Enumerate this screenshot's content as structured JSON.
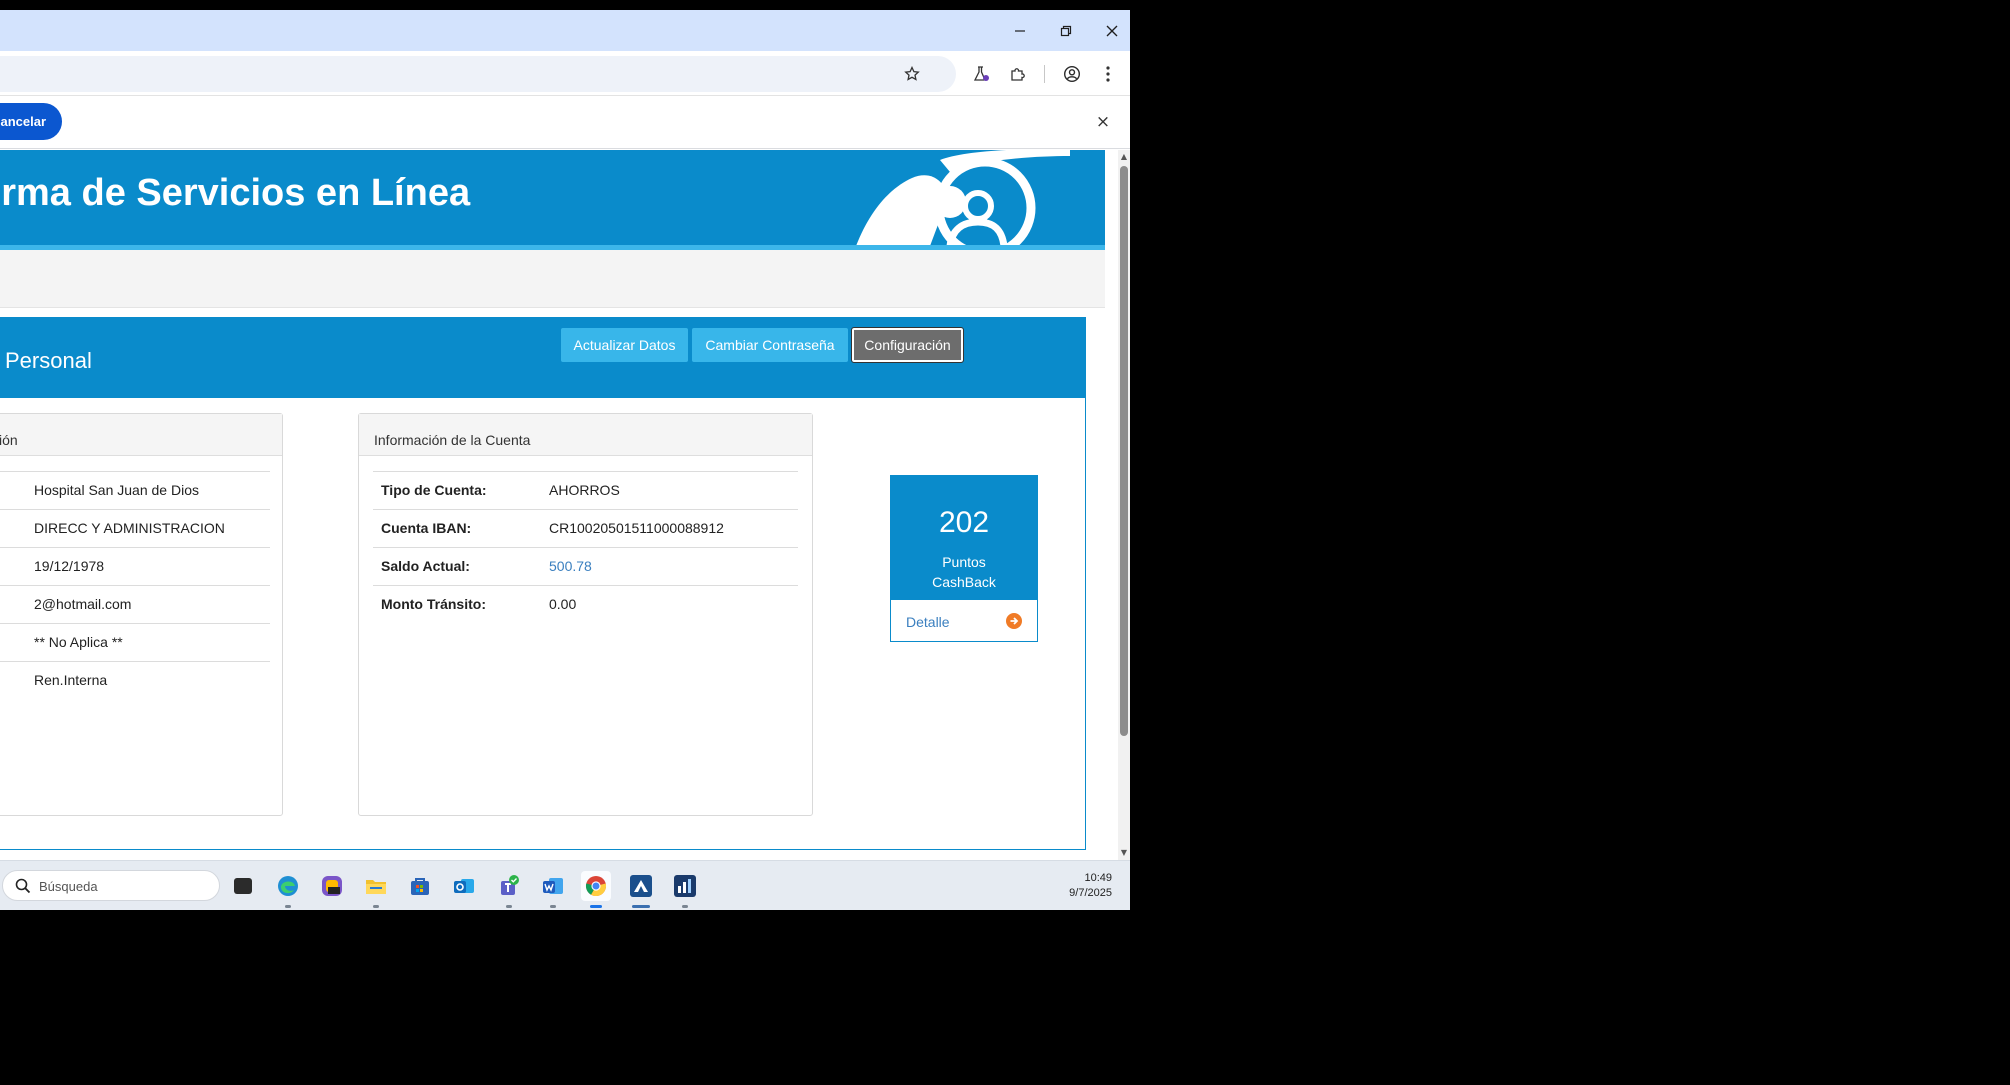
{
  "infobar": {
    "cancel_label": "Cancelar",
    "close_glyph": "×"
  },
  "banner": {
    "title": "orma de Servicios en Línea"
  },
  "panel": {
    "title": "Personal",
    "buttons": [
      "Actualizar Datos",
      "Cambiar Contraseña",
      "Configuración"
    ]
  },
  "personal_card": {
    "header": "ción",
    "rows": [
      {
        "key": ":",
        "value": "Hospital San Juan de Dios"
      },
      {
        "key": "",
        "value": "DIRECC Y ADMINISTRACION"
      },
      {
        "key": "",
        "value": "19/12/1978"
      },
      {
        "key": "",
        "value": "2@hotmail.com"
      },
      {
        "key": "",
        "value": "** No Aplica **"
      },
      {
        "key": "",
        "value": "Ren.Interna"
      }
    ]
  },
  "account_card": {
    "header": "Información de la Cuenta",
    "rows": [
      {
        "key": "Tipo de Cuenta:",
        "value": "AHORROS"
      },
      {
        "key": "Cuenta IBAN:",
        "value": "CR10020501511000088912"
      },
      {
        "key": "Saldo Actual:",
        "value": "500.78"
      },
      {
        "key": "Monto Tránsito:",
        "value": "0.00"
      }
    ]
  },
  "cashback": {
    "points": "202",
    "label_line1": "Puntos",
    "label_line2": "CashBack",
    "detail": "Detalle"
  },
  "taskbar": {
    "search_placeholder": "Búsqueda",
    "time": "10:49",
    "date": "9/7/2025",
    "apps": [
      {
        "name": "task-view",
        "color": "#2b2b2b"
      },
      {
        "name": "edge",
        "color": "#1f8fd3"
      },
      {
        "name": "m365",
        "color": "#7a55c8"
      },
      {
        "name": "file-explorer",
        "color": "#f2c12e"
      },
      {
        "name": "microsoft-store",
        "color": "#2a64b8"
      },
      {
        "name": "outlook",
        "color": "#0f6cbd"
      },
      {
        "name": "teams",
        "color": "#5b5fc7"
      },
      {
        "name": "word",
        "color": "#1e5bbd"
      },
      {
        "name": "chrome",
        "color": "#db4437"
      },
      {
        "name": "app-blue-triangle",
        "color": "#1b4f8c"
      },
      {
        "name": "app-dark-chart",
        "color": "#1a3a6b"
      }
    ]
  },
  "colors": {
    "brand": "#0a8bcb",
    "accent_light": "#38b6ea",
    "link": "#3a7fbf",
    "chrome_tab_bg": "#d3e3fd"
  }
}
